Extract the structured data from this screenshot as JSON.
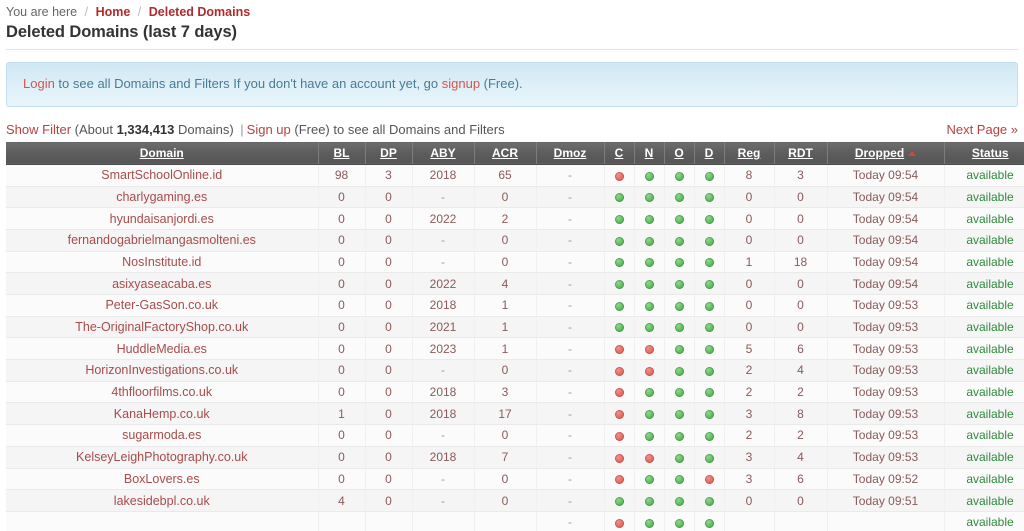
{
  "breadcrumb": {
    "prefix": "You are here",
    "separator": "/",
    "home": "Home",
    "current": "Deleted Domains"
  },
  "page_title": "Deleted Domains (last 7 days)",
  "info_banner": {
    "login_link": "Login",
    "text_mid": " to see all Domains and Filters If you don't have an account yet, go ",
    "signup_link": "signup",
    "text_end": " (Free)."
  },
  "filter_bar": {
    "show_filter": "Show Filter",
    "about_prefix": " (About ",
    "domain_count": "1,334,413",
    "about_suffix": " Domains) ",
    "pipe": "|",
    "signup": "Sign up",
    "tail": " (Free) to see all Domains and Filters",
    "next_page": "Next Page »"
  },
  "table": {
    "columns": [
      {
        "key": "domain",
        "label": "Domain",
        "sorted": false
      },
      {
        "key": "bl",
        "label": "BL",
        "sorted": false
      },
      {
        "key": "dp",
        "label": "DP",
        "sorted": false
      },
      {
        "key": "aby",
        "label": "ABY",
        "sorted": false
      },
      {
        "key": "acr",
        "label": "ACR",
        "sorted": false
      },
      {
        "key": "dmoz",
        "label": "Dmoz",
        "sorted": false
      },
      {
        "key": "c",
        "label": "C",
        "sorted": false
      },
      {
        "key": "n",
        "label": "N",
        "sorted": false
      },
      {
        "key": "o",
        "label": "O",
        "sorted": false
      },
      {
        "key": "d",
        "label": "D",
        "sorted": false
      },
      {
        "key": "reg",
        "label": "Reg",
        "sorted": false
      },
      {
        "key": "rdt",
        "label": "RDT",
        "sorted": false
      },
      {
        "key": "dropped",
        "label": "Dropped",
        "sorted": true
      },
      {
        "key": "status",
        "label": "Status",
        "sorted": false
      }
    ],
    "rows": [
      {
        "domain": "SmartSchoolOnline.id",
        "bl": "98",
        "dp": "3",
        "aby": "2018",
        "acr": "65",
        "dmoz": "-",
        "c": "red",
        "n": "green",
        "o": "green",
        "d": "green",
        "reg": "8",
        "rdt": "3",
        "dropped": "Today 09:54",
        "status": "available"
      },
      {
        "domain": "charlygaming.es",
        "bl": "0",
        "dp": "0",
        "aby": "-",
        "acr": "0",
        "dmoz": "-",
        "c": "green",
        "n": "green",
        "o": "green",
        "d": "green",
        "reg": "0",
        "rdt": "0",
        "dropped": "Today 09:54",
        "status": "available"
      },
      {
        "domain": "hyundaisanjordi.es",
        "bl": "0",
        "dp": "0",
        "aby": "2022",
        "acr": "2",
        "dmoz": "-",
        "c": "green",
        "n": "green",
        "o": "green",
        "d": "green",
        "reg": "0",
        "rdt": "0",
        "dropped": "Today 09:54",
        "status": "available"
      },
      {
        "domain": "fernandogabrielmangasmolteni.es",
        "bl": "0",
        "dp": "0",
        "aby": "-",
        "acr": "0",
        "dmoz": "-",
        "c": "green",
        "n": "green",
        "o": "green",
        "d": "green",
        "reg": "0",
        "rdt": "0",
        "dropped": "Today 09:54",
        "status": "available"
      },
      {
        "domain": "NosInstitute.id",
        "bl": "0",
        "dp": "0",
        "aby": "-",
        "acr": "0",
        "dmoz": "-",
        "c": "green",
        "n": "green",
        "o": "green",
        "d": "green",
        "reg": "1",
        "rdt": "18",
        "dropped": "Today 09:54",
        "status": "available"
      },
      {
        "domain": "asixyaseacaba.es",
        "bl": "0",
        "dp": "0",
        "aby": "2022",
        "acr": "4",
        "dmoz": "-",
        "c": "green",
        "n": "green",
        "o": "green",
        "d": "green",
        "reg": "0",
        "rdt": "0",
        "dropped": "Today 09:54",
        "status": "available"
      },
      {
        "domain": "Peter-GasSon.co.uk",
        "bl": "0",
        "dp": "0",
        "aby": "2018",
        "acr": "1",
        "dmoz": "-",
        "c": "green",
        "n": "green",
        "o": "green",
        "d": "green",
        "reg": "0",
        "rdt": "0",
        "dropped": "Today 09:53",
        "status": "available"
      },
      {
        "domain": "The-OriginalFactoryShop.co.uk",
        "bl": "0",
        "dp": "0",
        "aby": "2021",
        "acr": "1",
        "dmoz": "-",
        "c": "green",
        "n": "green",
        "o": "green",
        "d": "green",
        "reg": "0",
        "rdt": "0",
        "dropped": "Today 09:53",
        "status": "available"
      },
      {
        "domain": "HuddleMedia.es",
        "bl": "0",
        "dp": "0",
        "aby": "2023",
        "acr": "1",
        "dmoz": "-",
        "c": "red",
        "n": "red",
        "o": "green",
        "d": "green",
        "reg": "5",
        "rdt": "6",
        "dropped": "Today 09:53",
        "status": "available"
      },
      {
        "domain": "HorizonInvestigations.co.uk",
        "bl": "0",
        "dp": "0",
        "aby": "-",
        "acr": "0",
        "dmoz": "-",
        "c": "red",
        "n": "red",
        "o": "green",
        "d": "green",
        "reg": "2",
        "rdt": "4",
        "dropped": "Today 09:53",
        "status": "available"
      },
      {
        "domain": "4thfloorfilms.co.uk",
        "bl": "0",
        "dp": "0",
        "aby": "2018",
        "acr": "3",
        "dmoz": "-",
        "c": "red",
        "n": "green",
        "o": "green",
        "d": "green",
        "reg": "2",
        "rdt": "2",
        "dropped": "Today 09:53",
        "status": "available"
      },
      {
        "domain": "KanaHemp.co.uk",
        "bl": "1",
        "dp": "0",
        "aby": "2018",
        "acr": "17",
        "dmoz": "-",
        "c": "red",
        "n": "green",
        "o": "green",
        "d": "green",
        "reg": "3",
        "rdt": "8",
        "dropped": "Today 09:53",
        "status": "available"
      },
      {
        "domain": "sugarmoda.es",
        "bl": "0",
        "dp": "0",
        "aby": "-",
        "acr": "0",
        "dmoz": "-",
        "c": "red",
        "n": "green",
        "o": "green",
        "d": "green",
        "reg": "2",
        "rdt": "2",
        "dropped": "Today 09:53",
        "status": "available"
      },
      {
        "domain": "KelseyLeighPhotography.co.uk",
        "bl": "0",
        "dp": "0",
        "aby": "2018",
        "acr": "7",
        "dmoz": "-",
        "c": "red",
        "n": "red",
        "o": "green",
        "d": "green",
        "reg": "3",
        "rdt": "4",
        "dropped": "Today 09:53",
        "status": "available"
      },
      {
        "domain": "BoxLovers.es",
        "bl": "0",
        "dp": "0",
        "aby": "-",
        "acr": "0",
        "dmoz": "-",
        "c": "red",
        "n": "green",
        "o": "green",
        "d": "red",
        "reg": "3",
        "rdt": "6",
        "dropped": "Today 09:52",
        "status": "available"
      },
      {
        "domain": "lakesidebpl.co.uk",
        "bl": "4",
        "dp": "0",
        "aby": "-",
        "acr": "0",
        "dmoz": "-",
        "c": "green",
        "n": "green",
        "o": "green",
        "d": "green",
        "reg": "0",
        "rdt": "0",
        "dropped": "Today 09:51",
        "status": "available"
      },
      {
        "domain": "",
        "bl": "",
        "dp": "",
        "aby": "",
        "acr": "",
        "dmoz": "-",
        "c": "red",
        "n": "green",
        "o": "green",
        "d": "green",
        "reg": "",
        "rdt": "",
        "dropped": "",
        "status": "available"
      }
    ]
  }
}
